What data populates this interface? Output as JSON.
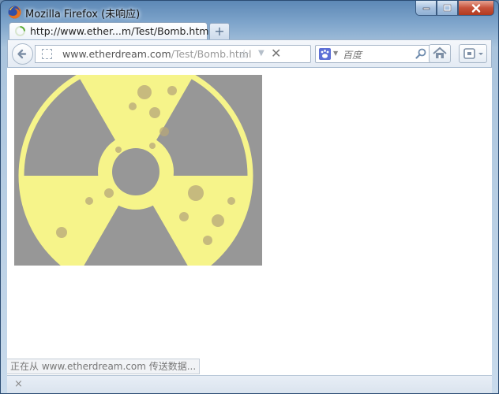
{
  "window": {
    "title": "Mozilla Firefox (未响应)",
    "icons": {
      "app": "firefox-icon",
      "minimize": "minimize-icon",
      "maximize": "maximize-icon",
      "close": "close-icon"
    }
  },
  "tabs": [
    {
      "title": "http://www.ether...m/Test/Bomb.html",
      "icon": "loading-spinner-icon"
    }
  ],
  "new_tab": {
    "label": "+"
  },
  "navbar": {
    "url": {
      "host": "www.etherdream.com",
      "path": "/Test/Bomb.html"
    },
    "stop_label": "✕",
    "search": {
      "placeholder": "百度",
      "engine_icon": "baidu-icon"
    }
  },
  "content": {
    "image": {
      "description_icon": "radiation-symbol-image",
      "background": "#979797",
      "symbol_color": "#f6f48a"
    }
  },
  "status": {
    "text": "正在从 www.etherdream.com 传送数据..."
  },
  "addon_bar": {
    "close_label": "×"
  },
  "colors": {
    "titlebar": "#5d88b6",
    "close_button": "#c7523a"
  }
}
